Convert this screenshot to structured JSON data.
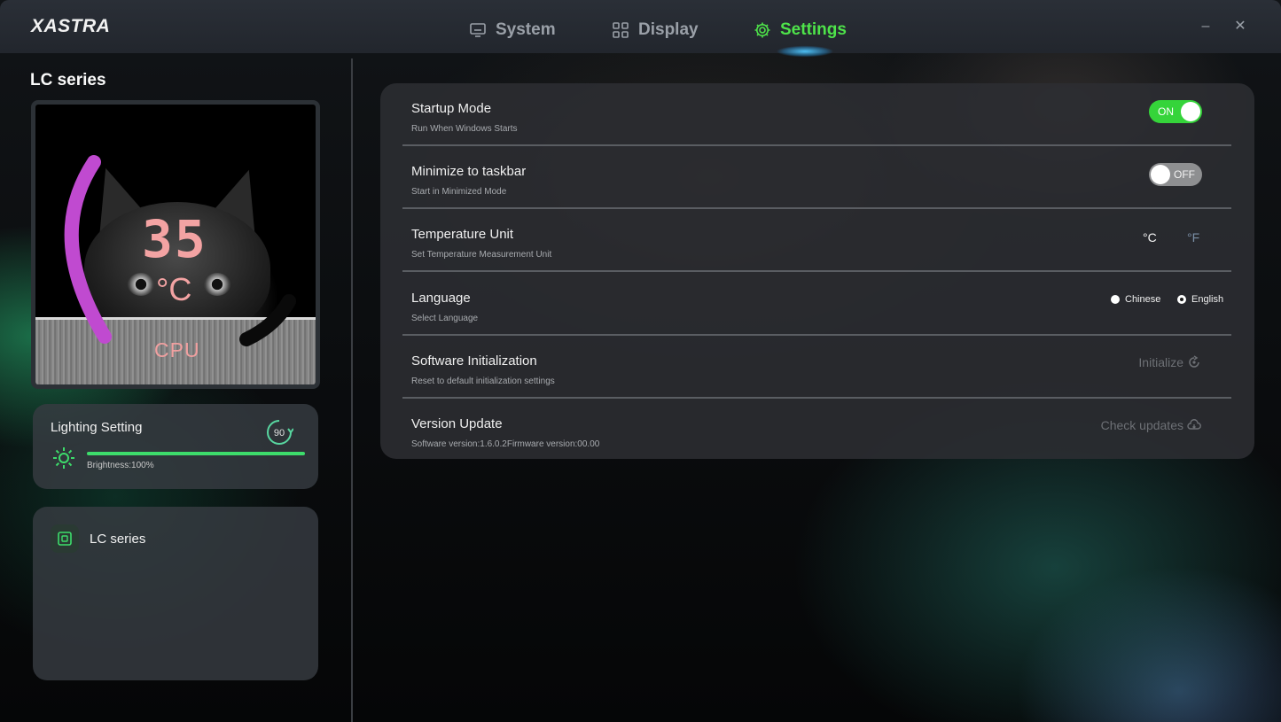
{
  "app": {
    "logo": "XASTRA",
    "nav": [
      {
        "label": "System",
        "icon": "monitor-icon",
        "active": false
      },
      {
        "label": "Display",
        "icon": "grid-icon",
        "active": false
      },
      {
        "label": "Settings",
        "icon": "gear-icon",
        "active": true
      }
    ],
    "window_controls": {
      "minimize": "–",
      "close": "✕"
    },
    "accent_color": "#4ee34a"
  },
  "sidebar": {
    "title": "LC series",
    "preview": {
      "temperature_value": "35",
      "temperature_unit": "°C",
      "sensor_label": "CPU",
      "gauge_color": "#c04ad0",
      "text_color": "#f3a3a3"
    },
    "lighting": {
      "title": "Lighting Setting",
      "rotation_value": "90",
      "brightness_percent": 100,
      "brightness_label": "Brightness:100%"
    },
    "devices": [
      {
        "label": "LC series",
        "icon": "device-icon"
      }
    ]
  },
  "settings": {
    "rows": [
      {
        "key": "startup",
        "title": "Startup Mode",
        "subtitle": "Run When Windows Starts",
        "control": "toggle",
        "toggle_state": "on",
        "toggle_label": "ON"
      },
      {
        "key": "minimize",
        "title": "Minimize to taskbar",
        "subtitle": "Start in Minimized Mode",
        "control": "toggle",
        "toggle_state": "off",
        "toggle_label": "OFF"
      },
      {
        "key": "temp_unit",
        "title": "Temperature Unit",
        "subtitle": "Set Temperature Measurement Unit",
        "control": "units",
        "options": [
          "°C",
          "°F"
        ],
        "selected": "°C"
      },
      {
        "key": "language",
        "title": "Language",
        "subtitle": "Select Language",
        "control": "radio",
        "options": [
          "Chinese",
          "English"
        ],
        "selected": "English"
      },
      {
        "key": "init",
        "title": "Software Initialization",
        "subtitle": "Reset to default initialization settings",
        "control": "action",
        "action_label": "Initialize",
        "action_icon": "reset-icon"
      },
      {
        "key": "update",
        "title": "Version Update",
        "subtitle": "Software version:1.6.0.2Firmware version:00.00",
        "control": "action",
        "action_label": "Check updates",
        "action_icon": "cloud-icon"
      }
    ]
  }
}
